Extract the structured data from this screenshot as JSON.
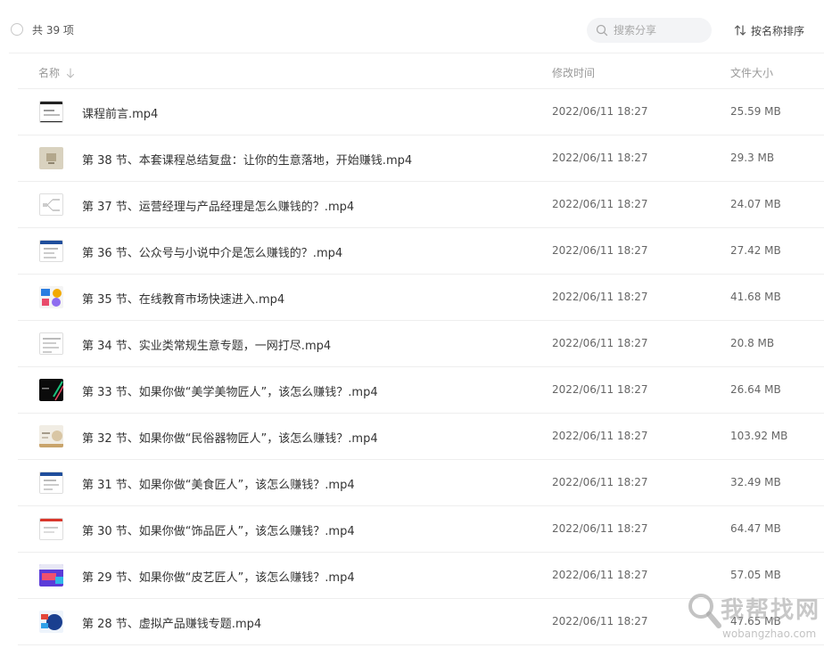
{
  "toolbar": {
    "count_label": "共 39 项",
    "search_placeholder": "搜索分享",
    "sort_label": "按名称排序"
  },
  "columns": {
    "name": "名称",
    "modified": "修改时间",
    "size": "文件大小"
  },
  "files": [
    {
      "name": "课程前言.mp4",
      "modified": "2022/06/11 18:27",
      "size": "25.59 MB"
    },
    {
      "name": "第 38 节、本套课程总结复盘：让你的生意落地，开始赚钱.mp4",
      "modified": "2022/06/11 18:27",
      "size": "29.3 MB"
    },
    {
      "name": "第 37 节、运营经理与产品经理是怎么赚钱的？.mp4",
      "modified": "2022/06/11 18:27",
      "size": "24.07 MB"
    },
    {
      "name": "第 36 节、公众号与小说中介是怎么赚钱的？.mp4",
      "modified": "2022/06/11 18:27",
      "size": "27.42 MB"
    },
    {
      "name": "第 35 节、在线教育市场快速进入.mp4",
      "modified": "2022/06/11 18:27",
      "size": "41.68 MB"
    },
    {
      "name": "第 34 节、实业类常规生意专题，一网打尽.mp4",
      "modified": "2022/06/11 18:27",
      "size": "20.8 MB"
    },
    {
      "name": "第 33 节、如果你做“美学美物匠人”，该怎么赚钱？.mp4",
      "modified": "2022/06/11 18:27",
      "size": "26.64 MB"
    },
    {
      "name": "第 32 节、如果你做“民俗器物匠人”，该怎么赚钱？.mp4",
      "modified": "2022/06/11 18:27",
      "size": "103.92 MB"
    },
    {
      "name": "第 31 节、如果你做“美食匠人”，该怎么赚钱？.mp4",
      "modified": "2022/06/11 18:27",
      "size": "32.49 MB"
    },
    {
      "name": "第 30 节、如果你做“饰品匠人”，该怎么赚钱？.mp4",
      "modified": "2022/06/11 18:27",
      "size": "64.47 MB"
    },
    {
      "name": "第 29 节、如果你做“皮艺匠人”，该怎么赚钱？.mp4",
      "modified": "2022/06/11 18:27",
      "size": "57.05 MB"
    },
    {
      "name": "第 28 节、虚拟产品赚钱专题.mp4",
      "modified": "2022/06/11 18:27",
      "size": "47.65 MB"
    }
  ],
  "watermark": {
    "text": "我帮找网",
    "url": "wobangzhao.com"
  }
}
